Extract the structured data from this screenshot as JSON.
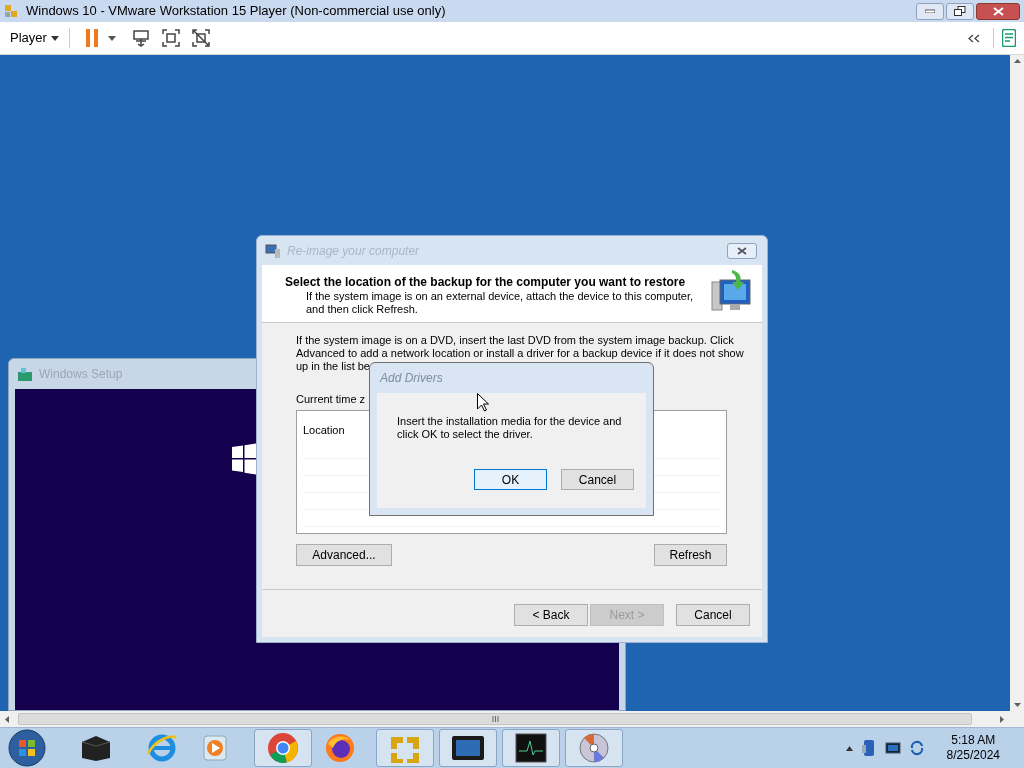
{
  "vm_window": {
    "title": "Windows 10 - VMware Workstation 15 Player (Non-commercial use only)",
    "menu": "Player"
  },
  "setup_window": {
    "title": "Windows Setup"
  },
  "reimage_dialog": {
    "title": "Re-image your computer",
    "heading": "Select the location of the backup for the computer you want to restore",
    "subheading_lines": [
      "If the system image is on an external device, attach the device to this computer,",
      "and then click Refresh."
    ],
    "instruction_lines": [
      "If the system image is on a DVD, insert the last DVD from the system image backup. Click",
      "Advanced to add a network location or install a driver for a backup device if it does not show",
      "up in the list be"
    ],
    "time_zone_label": "Current time z",
    "list_header": "Location",
    "advanced_button": "Advanced...",
    "refresh_button": "Refresh",
    "nav_buttons": [
      {
        "label": "< Back",
        "disabled": false
      },
      {
        "label": "Next >",
        "disabled": true
      },
      {
        "label": "Cancel",
        "disabled": false
      }
    ]
  },
  "add_drivers_dialog": {
    "title": "Add Drivers",
    "message_lines": [
      "Insert the installation media for the device and",
      "click OK to select the driver."
    ],
    "buttons": [
      {
        "label": "OK",
        "default": true
      },
      {
        "label": "Cancel",
        "default": false
      }
    ]
  },
  "taskbar": {
    "time": "5:18 AM",
    "date": "8/25/2024"
  }
}
